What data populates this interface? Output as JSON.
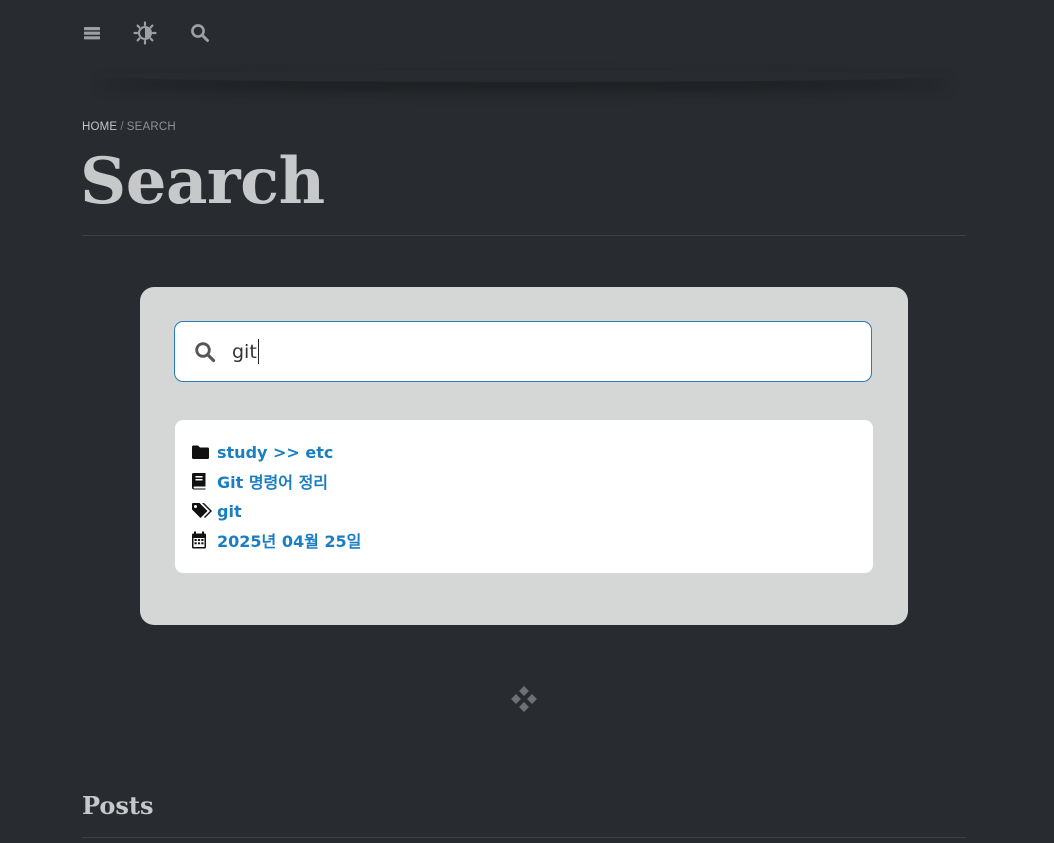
{
  "header": {
    "icons": [
      "menu-icon",
      "theme-toggle-icon",
      "search-icon"
    ]
  },
  "breadcrumb": {
    "home": "HOME",
    "separator": "/",
    "current": "SEARCH"
  },
  "page": {
    "title": "Search"
  },
  "search": {
    "value": "git",
    "icon": "search-icon"
  },
  "result": {
    "category": "study >> etc",
    "title": "Git 명령어 정리",
    "tag": "git",
    "date": "2025년 04월 25일",
    "icons": [
      "folder-icon",
      "book-icon",
      "tags-icon",
      "calendar-icon"
    ]
  },
  "divider": {
    "icon": "diamonds-icon"
  },
  "posts": {
    "heading": "Posts"
  },
  "colors": {
    "background": "#282b2f",
    "panel": "#d5d7d7",
    "link": "#1a7ec2",
    "input_border": "#2a7bb8",
    "title": "#c6c8ca"
  }
}
